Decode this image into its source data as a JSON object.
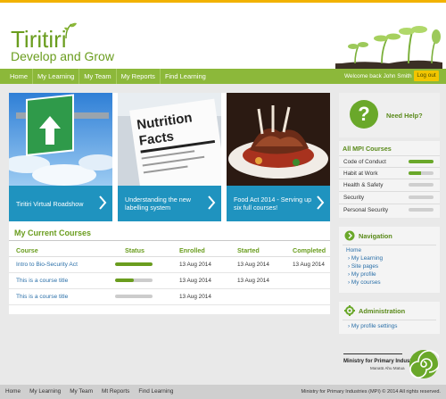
{
  "header": {
    "title": "Tiritiri",
    "subtitle": "Develop and Grow"
  },
  "nav": {
    "items": [
      "Home",
      "My Learning",
      "My Team",
      "My Reports",
      "Find Learning"
    ],
    "welcome": "Welcome back John Smith",
    "logout": "Log out"
  },
  "tiles": [
    {
      "caption": "Tiritiri Virtual Roadshow",
      "image": "road-sign-arrow"
    },
    {
      "caption": "Understanding the new labelling system",
      "image": "nutrition-facts-label",
      "photo_text": [
        "Nutrition",
        "Facts"
      ]
    },
    {
      "caption": "Food Act 2014 - Serving up six full courses!",
      "image": "lamb-rack-dish"
    }
  ],
  "courses": {
    "title": "My Current Courses",
    "columns": [
      "Course",
      "Status",
      "Enrolled",
      "Started",
      "Completed"
    ],
    "rows": [
      {
        "course": "Intro to Bio-Security Act",
        "progress": 1.0,
        "enrolled": "13 Aug 2014",
        "started": "13 Aug 2014",
        "completed": "13 Aug 2014"
      },
      {
        "course": "This is a course title",
        "progress": 0.5,
        "enrolled": "13 Aug 2014",
        "started": "13 Aug 2014",
        "completed": ""
      },
      {
        "course": "This is a course title",
        "progress": 0.0,
        "enrolled": "13 Aug 2014",
        "started": "",
        "completed": ""
      }
    ]
  },
  "help": {
    "label": "Need Help?",
    "icon": "question-icon"
  },
  "mpi_courses": {
    "title": "All MPI Courses",
    "items": [
      {
        "label": "Code of Conduct",
        "progress": 1.0
      },
      {
        "label": "Habit at Work",
        "progress": 0.5
      },
      {
        "label": "Health & Safety",
        "progress": 0.0
      },
      {
        "label": "Security",
        "progress": 0.0
      },
      {
        "label": "Personal Security",
        "progress": 0.0
      }
    ]
  },
  "navigation": {
    "title": "Navigation",
    "home": "Home",
    "links": [
      "My Learning",
      "Site pages",
      "My profile",
      "My courses"
    ]
  },
  "administration": {
    "title": "Administration",
    "links": [
      "My profile settings"
    ]
  },
  "brand": {
    "ministry": "Ministry for Primary Industries",
    "maori": "Manatū Ahu Matua"
  },
  "footer": {
    "links": [
      "Home",
      "My Learning",
      "My Team",
      "Mt Reports",
      "Find Learning"
    ],
    "copyright": "Ministry for Primary Industries (MPI) © 2014 All rights reserved."
  },
  "colors": {
    "accent_green": "#8cb83a",
    "text_green": "#6a9d1e",
    "tile_blue": "#1f93bf",
    "logout_yellow": "#f2c500",
    "top_stripe": "#f2b200"
  }
}
